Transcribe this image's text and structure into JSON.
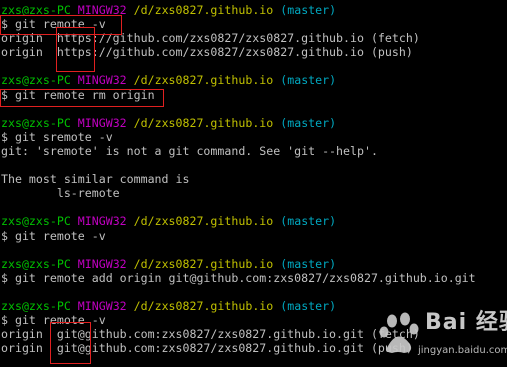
{
  "prompt": {
    "user": "zxs@zxs-PC",
    "host": "MINGW32",
    "path": "/d/zxs0827.github.io",
    "branch": "(master)"
  },
  "lines": [
    {
      "type": "prompt"
    },
    {
      "type": "text",
      "text": "$ git remote -v"
    },
    {
      "type": "text",
      "text": "origin  https://github.com/zxs0827/zxs0827.github.io (fetch)"
    },
    {
      "type": "text",
      "text": "origin  https://github.com/zxs0827/zxs0827.github.io (push)"
    },
    {
      "type": "blank"
    },
    {
      "type": "prompt"
    },
    {
      "type": "text",
      "text": "$ git remote rm origin"
    },
    {
      "type": "blank"
    },
    {
      "type": "prompt"
    },
    {
      "type": "text",
      "text": "$ git sremote -v"
    },
    {
      "type": "text",
      "text": "git: 'sremote' is not a git command. See 'git --help'."
    },
    {
      "type": "blank"
    },
    {
      "type": "text",
      "text": "The most similar command is"
    },
    {
      "type": "text",
      "text": "        ls-remote"
    },
    {
      "type": "blank"
    },
    {
      "type": "prompt"
    },
    {
      "type": "text",
      "text": "$ git remote -v"
    },
    {
      "type": "blank"
    },
    {
      "type": "prompt"
    },
    {
      "type": "text",
      "text": "$ git remote add origin git@github.com:zxs0827/zxs0827.github.io.git"
    },
    {
      "type": "blank"
    },
    {
      "type": "prompt"
    },
    {
      "type": "text",
      "text": "$ git remote -v"
    },
    {
      "type": "text",
      "text": "origin  git@github.com:zxs0827/zxs0827.github.io.git (fetch)"
    },
    {
      "type": "text",
      "text": "origin  git@github.com:zxs0827/zxs0827.github.io.git (push)"
    }
  ],
  "watermark": {
    "brand": "Bai 经验",
    "sub": "jingyan.baidu.com"
  },
  "colors": {
    "background": "#000000",
    "text": "#c0c0c0",
    "user": "#00c000",
    "host": "#c000c0",
    "path": "#c0c000",
    "branch": "#00a8c0",
    "annotation": "#e02020"
  }
}
